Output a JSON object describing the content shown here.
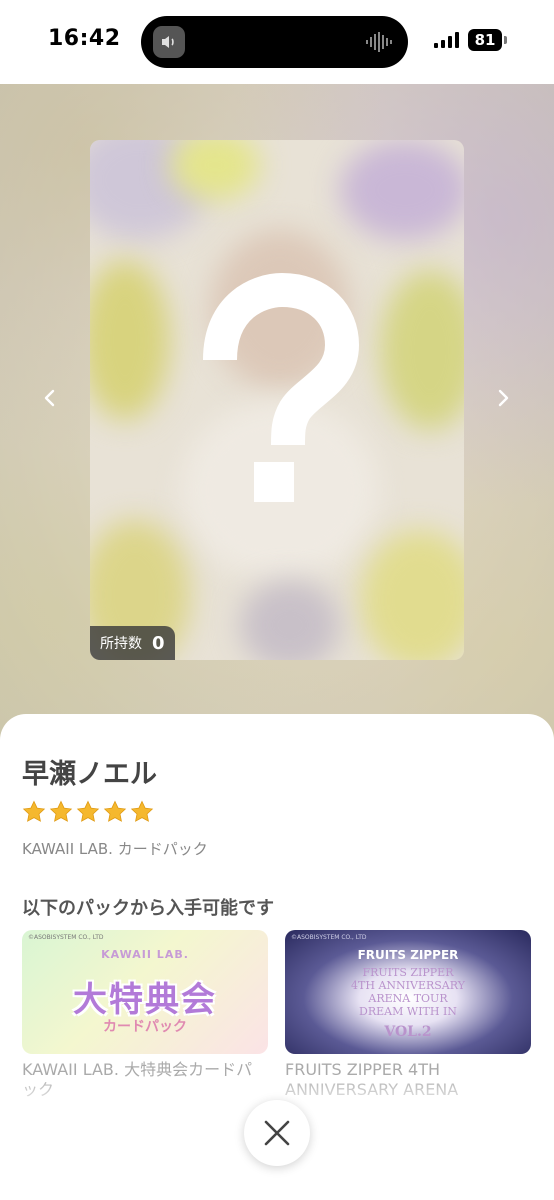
{
  "status": {
    "time": "16:42",
    "battery": "81"
  },
  "card": {
    "owned_label": "所持数",
    "owned_count": "0",
    "placeholder_glyph": "?"
  },
  "detail": {
    "name": "早瀬ノエル",
    "rating": 5,
    "series": "KAWAII LAB. カードパック",
    "available_heading": "以下のパックから入手可能です"
  },
  "packs": [
    {
      "copyright": "©ASOBISYSTEM CO., LTD",
      "art_small": "KAWAII LAB.",
      "art_big": "大特典会",
      "art_sub": "カードパック",
      "caption": "KAWAII LAB. 大特典会カードパック"
    },
    {
      "copyright": "©ASOBISYSTEM CO., LTD",
      "art_brand": "FRUITS ZIPPER",
      "art_line1": "FRUITS ZIPPER",
      "art_line2": "4TH ANNIVERSARY",
      "art_line3": "ARENA TOUR",
      "art_line4": "DREAM WITH IN",
      "art_vol": "VOL.2",
      "caption": "FRUITS ZIPPER 4TH ANNIVERSARY ARENA"
    }
  ],
  "colors": {
    "star": "#f5b82e",
    "sheet_bg": "#ffffff",
    "card_badge": "#3c3c3c"
  },
  "icons": {
    "prev": "chevron-left-icon",
    "next": "chevron-right-icon",
    "close": "close-icon",
    "star": "star-icon"
  }
}
